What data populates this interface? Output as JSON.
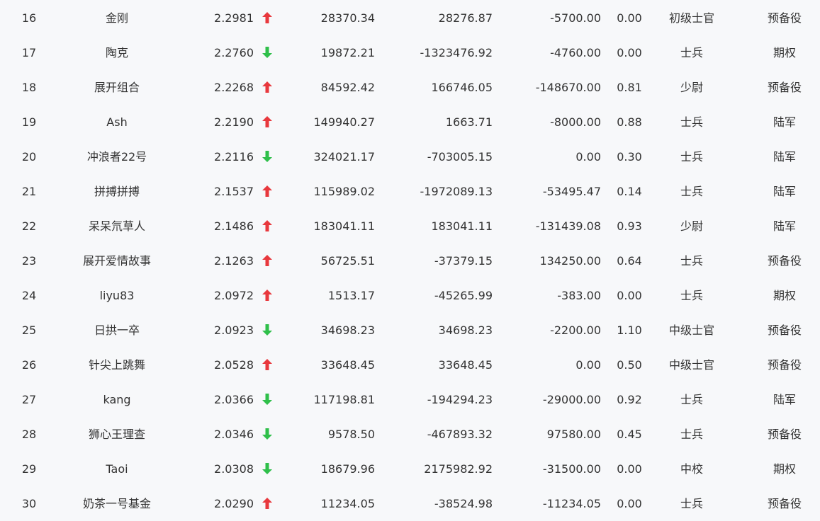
{
  "colors": {
    "up": "#e8383d",
    "down": "#2fbf4a",
    "text": "#333333",
    "background": "#f7f8fa"
  },
  "rows": [
    {
      "rank": "16",
      "name": "金刚",
      "score": "2.2981",
      "trend": "up",
      "v1": "28370.34",
      "v2": "28276.87",
      "v3": "-5700.00",
      "ratio": "0.00",
      "title": "初级士官",
      "category": "预备役"
    },
    {
      "rank": "17",
      "name": "陶克",
      "score": "2.2760",
      "trend": "down",
      "v1": "19872.21",
      "v2": "-1323476.92",
      "v3": "-4760.00",
      "ratio": "0.00",
      "title": "士兵",
      "category": "期权"
    },
    {
      "rank": "18",
      "name": "展开组合",
      "score": "2.2268",
      "trend": "up",
      "v1": "84592.42",
      "v2": "166746.05",
      "v3": "-148670.00",
      "ratio": "0.81",
      "title": "少尉",
      "category": "预备役"
    },
    {
      "rank": "19",
      "name": "Ash",
      "score": "2.2190",
      "trend": "up",
      "v1": "149940.27",
      "v2": "1663.71",
      "v3": "-8000.00",
      "ratio": "0.88",
      "title": "士兵",
      "category": "陆军"
    },
    {
      "rank": "20",
      "name": "冲浪者22号",
      "score": "2.2116",
      "trend": "down",
      "v1": "324021.17",
      "v2": "-703005.15",
      "v3": "0.00",
      "ratio": "0.30",
      "title": "士兵",
      "category": "陆军"
    },
    {
      "rank": "21",
      "name": "拼搏拼搏",
      "score": "2.1537",
      "trend": "up",
      "v1": "115989.02",
      "v2": "-1972089.13",
      "v3": "-53495.47",
      "ratio": "0.14",
      "title": "士兵",
      "category": "陆军"
    },
    {
      "rank": "22",
      "name": "呆呆氘草人",
      "score": "2.1486",
      "trend": "up",
      "v1": "183041.11",
      "v2": "183041.11",
      "v3": "-131439.08",
      "ratio": "0.93",
      "title": "少尉",
      "category": "陆军"
    },
    {
      "rank": "23",
      "name": "展开爱情故事",
      "score": "2.1263",
      "trend": "up",
      "v1": "56725.51",
      "v2": "-37379.15",
      "v3": "134250.00",
      "ratio": "0.64",
      "title": "士兵",
      "category": "预备役"
    },
    {
      "rank": "24",
      "name": "liyu83",
      "score": "2.0972",
      "trend": "up",
      "v1": "1513.17",
      "v2": "-45265.99",
      "v3": "-383.00",
      "ratio": "0.00",
      "title": "士兵",
      "category": "期权"
    },
    {
      "rank": "25",
      "name": "日拱一卒",
      "score": "2.0923",
      "trend": "down",
      "v1": "34698.23",
      "v2": "34698.23",
      "v3": "-2200.00",
      "ratio": "1.10",
      "title": "中级士官",
      "category": "预备役"
    },
    {
      "rank": "26",
      "name": "针尖上跳舞",
      "score": "2.0528",
      "trend": "up",
      "v1": "33648.45",
      "v2": "33648.45",
      "v3": "0.00",
      "ratio": "0.50",
      "title": "中级士官",
      "category": "预备役"
    },
    {
      "rank": "27",
      "name": "kang",
      "score": "2.0366",
      "trend": "down",
      "v1": "117198.81",
      "v2": "-194294.23",
      "v3": "-29000.00",
      "ratio": "0.92",
      "title": "士兵",
      "category": "陆军"
    },
    {
      "rank": "28",
      "name": "狮心王理查",
      "score": "2.0346",
      "trend": "down",
      "v1": "9578.50",
      "v2": "-467893.32",
      "v3": "97580.00",
      "ratio": "0.45",
      "title": "士兵",
      "category": "预备役"
    },
    {
      "rank": "29",
      "name": "Taoi",
      "score": "2.0308",
      "trend": "down",
      "v1": "18679.96",
      "v2": "2175982.92",
      "v3": "-31500.00",
      "ratio": "0.00",
      "title": "中校",
      "category": "期权"
    },
    {
      "rank": "30",
      "name": "奶茶一号基金",
      "score": "2.0290",
      "trend": "up",
      "v1": "11234.05",
      "v2": "-38524.98",
      "v3": "-11234.05",
      "ratio": "0.00",
      "title": "士兵",
      "category": "预备役"
    }
  ]
}
